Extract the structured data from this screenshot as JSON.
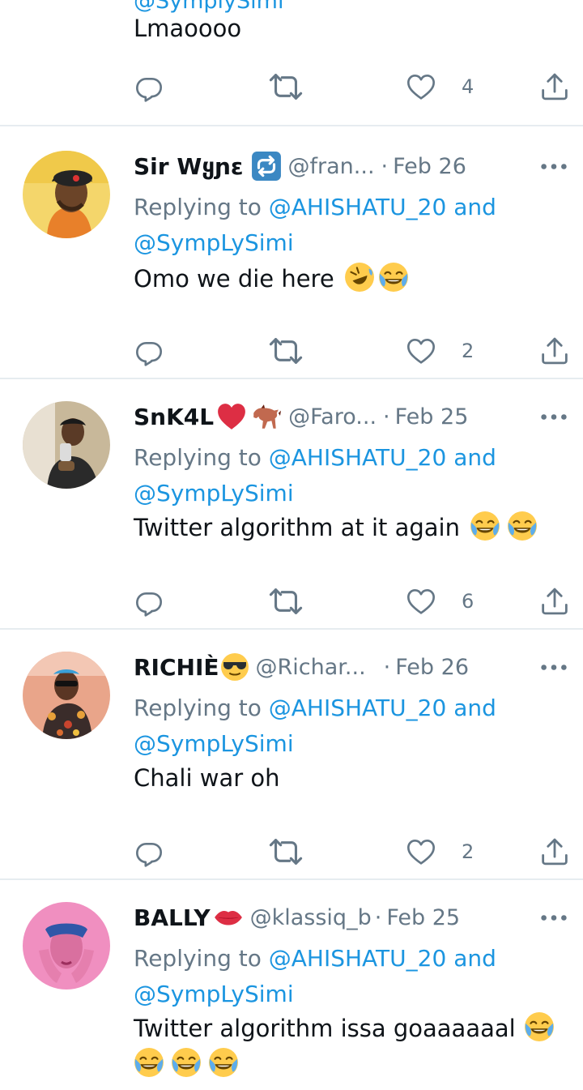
{
  "first_tweet": {
    "cut_handle": "@SymplySimi",
    "text": "Lmaoooo",
    "likes": "4"
  },
  "tweets": [
    {
      "name": "Sir Wყɲɛ",
      "handle": "@fran...",
      "date": "Feb 26",
      "dot": "·",
      "reply_prefix": "Replying to",
      "mention1": "@AHISHATU_20",
      "and": "and",
      "mention2": "@SympLySimi",
      "text": "Omo we die here",
      "likes": "2",
      "name_emojis": [
        "repeat-square-emoji"
      ],
      "text_emojis": [
        "rolling-laughing-emoji",
        "tears-of-joy-emoji"
      ]
    },
    {
      "name": "SnK4L",
      "handle": "@Faro...",
      "date": "Feb 25",
      "dot": "·",
      "reply_prefix": "Replying to",
      "mention1": "@AHISHATU_20",
      "and": "and",
      "mention2": "@SympLySimi",
      "text": "Twitter algorithm at it again",
      "likes": "6",
      "name_emojis": [
        "red-heart-emoji",
        "horse-emoji"
      ],
      "text_emojis": [
        "tears-of-joy-emoji",
        "tears-of-joy-emoji"
      ]
    },
    {
      "name": "RICHIÈ",
      "handle": "@Richar...",
      "date": "Feb 26",
      "dot": "·",
      "reply_prefix": "Replying to",
      "mention1": "@AHISHATU_20",
      "and": "and",
      "mention2": "@SympLySimi",
      "text": "Chali war oh",
      "likes": "2",
      "name_emojis": [
        "sunglasses-emoji"
      ],
      "text_emojis": []
    },
    {
      "name": "BALLY",
      "handle": "@klassiq_b",
      "date": "Feb 25",
      "dot": "·",
      "reply_prefix": "Replying to",
      "mention1": "@AHISHATU_20",
      "and": "and",
      "mention2": "@SympLySimi",
      "text": "Twitter algorithm issa goaaaaaal",
      "likes": "",
      "name_emojis": [
        "kiss-lips-emoji"
      ],
      "text_emojis": [
        "tears-of-joy-emoji",
        "tears-of-joy-emoji",
        "tears-of-joy-emoji",
        "tears-of-joy-emoji"
      ]
    }
  ],
  "colors": {
    "link": "#1b95e0",
    "secondary_text": "#657786",
    "divider": "#e6ecf0"
  },
  "icons": {
    "reply": "reply-icon",
    "retweet": "retweet-icon",
    "like": "heart-icon",
    "share": "share-icon",
    "more": "more-icon"
  }
}
